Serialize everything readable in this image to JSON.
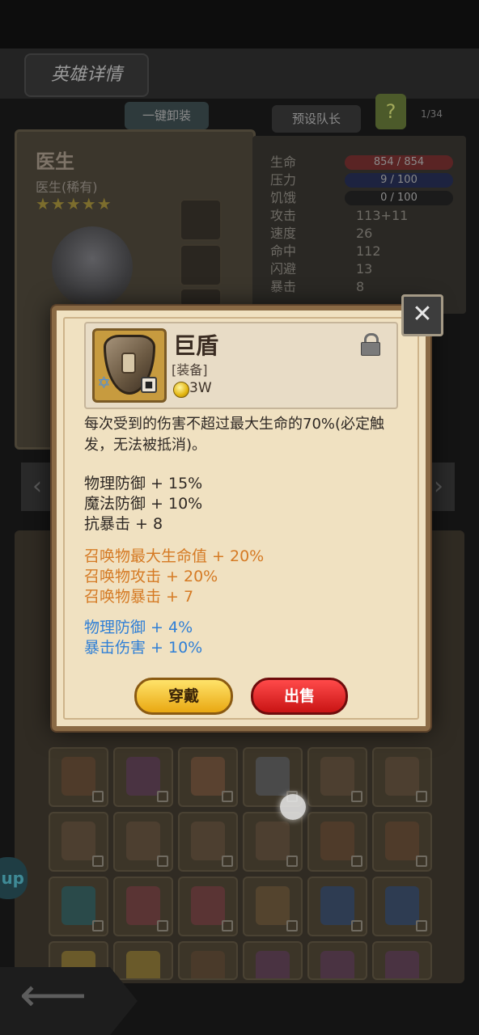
{
  "header": {
    "title": "英雄详情",
    "unequip_all": "一键卸装",
    "preset_leader": "预设队长",
    "help": "?",
    "page_count": "1/34"
  },
  "hero": {
    "name": "医生",
    "subtitle": "医生(稀有)",
    "stars": "★★★★★"
  },
  "stats": {
    "hp_label": "生命",
    "hp_value": "854 / 854",
    "stress_label": "压力",
    "stress_value": "9 / 100",
    "hunger_label": "饥饿",
    "hunger_value": "0 / 100",
    "attack_label": "攻击",
    "attack_value": "113+11",
    "speed_label": "速度",
    "speed_value": "26",
    "hit_label": "命中",
    "hit_value": "112",
    "dodge_label": "闪避",
    "dodge_value": "13",
    "crit_label": "暴击",
    "crit_value": "8"
  },
  "item": {
    "name": "巨盾",
    "type": "[装备]",
    "price": "3W",
    "description": "每次受到的伤害不超过最大生命的70%(必定触发，无法被抵消)。",
    "base_attrs": [
      "物理防御 + 15%",
      "魔法防御 + 10%",
      "抗暴击 + 8"
    ],
    "summon_attrs": [
      "召唤物最大生命值 + 20%",
      "召唤物攻击 + 20%",
      "召唤物暴击 + 7"
    ],
    "bonus_attrs": [
      "物理防御 + 4%",
      "暴击伤害 + 10%"
    ],
    "equip_label": "穿戴",
    "sell_label": "出售"
  },
  "side": {
    "up_label": "up"
  },
  "colors": {
    "summon_attr": "#d57a24",
    "bonus_attr": "#2f7fd6",
    "equip_button": "#f2c232",
    "sell_button": "#e22525"
  }
}
